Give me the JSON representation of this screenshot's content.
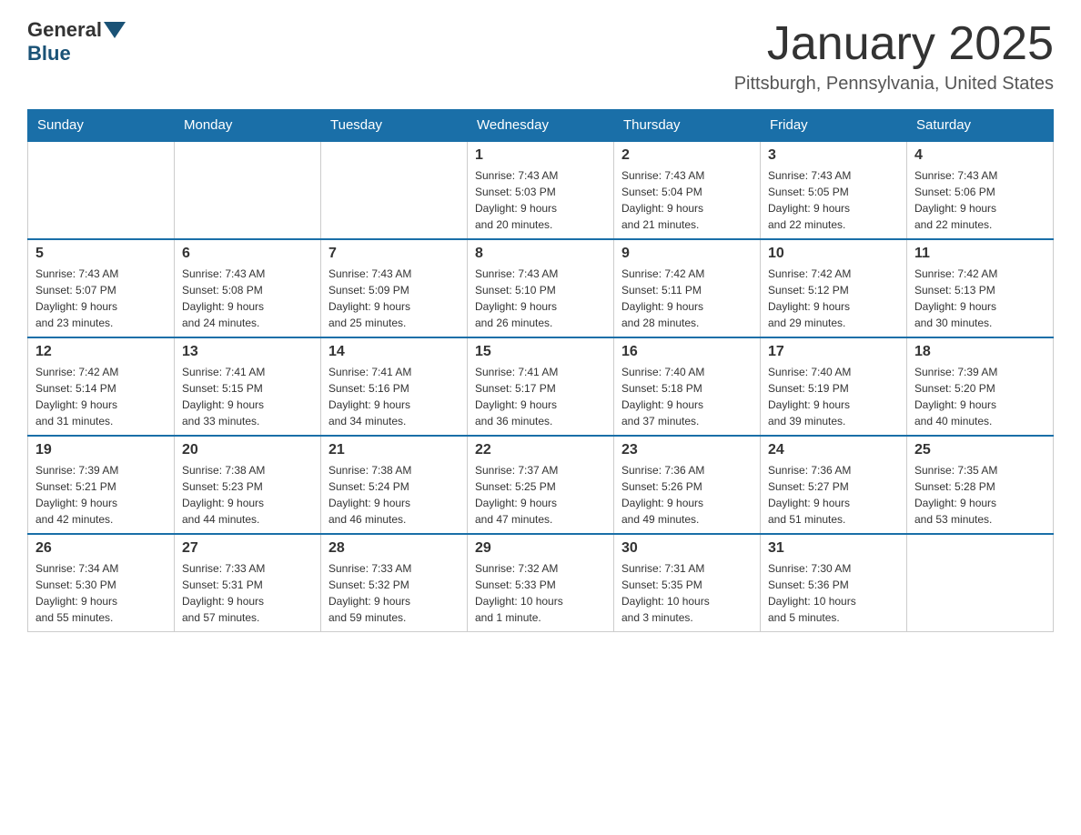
{
  "logo": {
    "general": "General",
    "blue": "Blue"
  },
  "title": "January 2025",
  "location": "Pittsburgh, Pennsylvania, United States",
  "weekdays": [
    "Sunday",
    "Monday",
    "Tuesday",
    "Wednesday",
    "Thursday",
    "Friday",
    "Saturday"
  ],
  "weeks": [
    [
      {
        "day": "",
        "info": ""
      },
      {
        "day": "",
        "info": ""
      },
      {
        "day": "",
        "info": ""
      },
      {
        "day": "1",
        "info": "Sunrise: 7:43 AM\nSunset: 5:03 PM\nDaylight: 9 hours\nand 20 minutes."
      },
      {
        "day": "2",
        "info": "Sunrise: 7:43 AM\nSunset: 5:04 PM\nDaylight: 9 hours\nand 21 minutes."
      },
      {
        "day": "3",
        "info": "Sunrise: 7:43 AM\nSunset: 5:05 PM\nDaylight: 9 hours\nand 22 minutes."
      },
      {
        "day": "4",
        "info": "Sunrise: 7:43 AM\nSunset: 5:06 PM\nDaylight: 9 hours\nand 22 minutes."
      }
    ],
    [
      {
        "day": "5",
        "info": "Sunrise: 7:43 AM\nSunset: 5:07 PM\nDaylight: 9 hours\nand 23 minutes."
      },
      {
        "day": "6",
        "info": "Sunrise: 7:43 AM\nSunset: 5:08 PM\nDaylight: 9 hours\nand 24 minutes."
      },
      {
        "day": "7",
        "info": "Sunrise: 7:43 AM\nSunset: 5:09 PM\nDaylight: 9 hours\nand 25 minutes."
      },
      {
        "day": "8",
        "info": "Sunrise: 7:43 AM\nSunset: 5:10 PM\nDaylight: 9 hours\nand 26 minutes."
      },
      {
        "day": "9",
        "info": "Sunrise: 7:42 AM\nSunset: 5:11 PM\nDaylight: 9 hours\nand 28 minutes."
      },
      {
        "day": "10",
        "info": "Sunrise: 7:42 AM\nSunset: 5:12 PM\nDaylight: 9 hours\nand 29 minutes."
      },
      {
        "day": "11",
        "info": "Sunrise: 7:42 AM\nSunset: 5:13 PM\nDaylight: 9 hours\nand 30 minutes."
      }
    ],
    [
      {
        "day": "12",
        "info": "Sunrise: 7:42 AM\nSunset: 5:14 PM\nDaylight: 9 hours\nand 31 minutes."
      },
      {
        "day": "13",
        "info": "Sunrise: 7:41 AM\nSunset: 5:15 PM\nDaylight: 9 hours\nand 33 minutes."
      },
      {
        "day": "14",
        "info": "Sunrise: 7:41 AM\nSunset: 5:16 PM\nDaylight: 9 hours\nand 34 minutes."
      },
      {
        "day": "15",
        "info": "Sunrise: 7:41 AM\nSunset: 5:17 PM\nDaylight: 9 hours\nand 36 minutes."
      },
      {
        "day": "16",
        "info": "Sunrise: 7:40 AM\nSunset: 5:18 PM\nDaylight: 9 hours\nand 37 minutes."
      },
      {
        "day": "17",
        "info": "Sunrise: 7:40 AM\nSunset: 5:19 PM\nDaylight: 9 hours\nand 39 minutes."
      },
      {
        "day": "18",
        "info": "Sunrise: 7:39 AM\nSunset: 5:20 PM\nDaylight: 9 hours\nand 40 minutes."
      }
    ],
    [
      {
        "day": "19",
        "info": "Sunrise: 7:39 AM\nSunset: 5:21 PM\nDaylight: 9 hours\nand 42 minutes."
      },
      {
        "day": "20",
        "info": "Sunrise: 7:38 AM\nSunset: 5:23 PM\nDaylight: 9 hours\nand 44 minutes."
      },
      {
        "day": "21",
        "info": "Sunrise: 7:38 AM\nSunset: 5:24 PM\nDaylight: 9 hours\nand 46 minutes."
      },
      {
        "day": "22",
        "info": "Sunrise: 7:37 AM\nSunset: 5:25 PM\nDaylight: 9 hours\nand 47 minutes."
      },
      {
        "day": "23",
        "info": "Sunrise: 7:36 AM\nSunset: 5:26 PM\nDaylight: 9 hours\nand 49 minutes."
      },
      {
        "day": "24",
        "info": "Sunrise: 7:36 AM\nSunset: 5:27 PM\nDaylight: 9 hours\nand 51 minutes."
      },
      {
        "day": "25",
        "info": "Sunrise: 7:35 AM\nSunset: 5:28 PM\nDaylight: 9 hours\nand 53 minutes."
      }
    ],
    [
      {
        "day": "26",
        "info": "Sunrise: 7:34 AM\nSunset: 5:30 PM\nDaylight: 9 hours\nand 55 minutes."
      },
      {
        "day": "27",
        "info": "Sunrise: 7:33 AM\nSunset: 5:31 PM\nDaylight: 9 hours\nand 57 minutes."
      },
      {
        "day": "28",
        "info": "Sunrise: 7:33 AM\nSunset: 5:32 PM\nDaylight: 9 hours\nand 59 minutes."
      },
      {
        "day": "29",
        "info": "Sunrise: 7:32 AM\nSunset: 5:33 PM\nDaylight: 10 hours\nand 1 minute."
      },
      {
        "day": "30",
        "info": "Sunrise: 7:31 AM\nSunset: 5:35 PM\nDaylight: 10 hours\nand 3 minutes."
      },
      {
        "day": "31",
        "info": "Sunrise: 7:30 AM\nSunset: 5:36 PM\nDaylight: 10 hours\nand 5 minutes."
      },
      {
        "day": "",
        "info": ""
      }
    ]
  ]
}
